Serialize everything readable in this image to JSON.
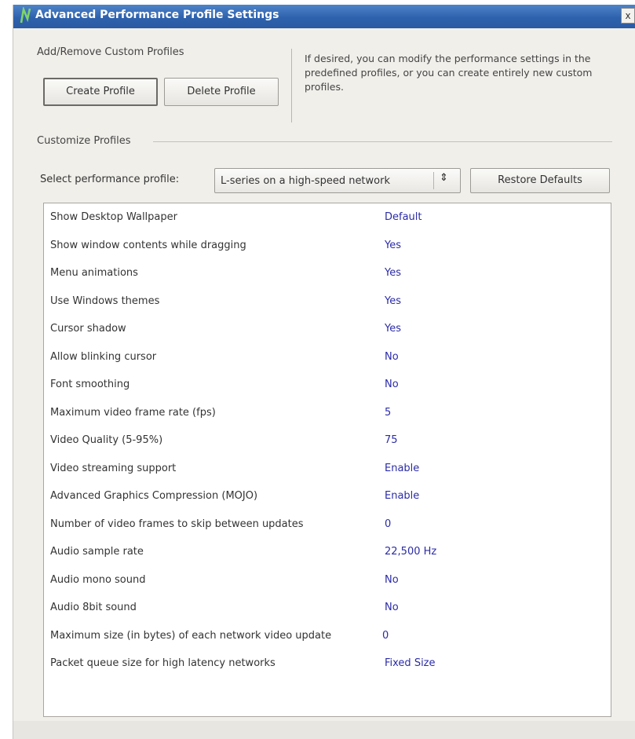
{
  "window": {
    "title": "Advanced Performance Profile Settings",
    "close_label": "x"
  },
  "custom_profiles": {
    "group_label": "Add/Remove Custom Profiles",
    "create_button": "Create Profile",
    "delete_button": "Delete Profile",
    "info": "If desired, you can modify the performance settings in the predefined profiles, or you can create entirely new custom profiles."
  },
  "customize": {
    "group_label": "Customize Profiles",
    "select_label": "Select performance profile:",
    "selected_profile": "L-series on a high-speed network",
    "select_arrows": "⇕",
    "restore_button": "Restore Defaults"
  },
  "settings": [
    {
      "name": "Show Desktop Wallpaper",
      "value": "Default"
    },
    {
      "name": "Show window contents while dragging",
      "value": "Yes"
    },
    {
      "name": "Menu animations",
      "value": "Yes"
    },
    {
      "name": "Use Windows themes",
      "value": "Yes"
    },
    {
      "name": "Cursor shadow",
      "value": "Yes"
    },
    {
      "name": "Allow blinking cursor",
      "value": "No"
    },
    {
      "name": "Font smoothing",
      "value": "No"
    },
    {
      "name": "Maximum video frame rate (fps)",
      "value": "5"
    },
    {
      "name": "Video Quality (5-95%)",
      "value": "75"
    },
    {
      "name": "Video streaming support",
      "value": "Enable"
    },
    {
      "name": "Advanced Graphics Compression (MOJO)",
      "value": "Enable"
    },
    {
      "name": "Number of video frames to skip between updates",
      "value": "0"
    },
    {
      "name": "Audio sample rate",
      "value": "22,500 Hz"
    },
    {
      "name": "Audio mono sound",
      "value": "No"
    },
    {
      "name": "Audio 8bit sound",
      "value": "No"
    },
    {
      "name": "Maximum size (in bytes) of each network video update",
      "value": "0"
    },
    {
      "name": "Packet queue size for high latency networks",
      "value": "Fixed Size"
    }
  ],
  "colors": {
    "title_bar": "#2f62ad",
    "value_text": "#2b2ba8",
    "dialog_bg": "#f1efea"
  }
}
